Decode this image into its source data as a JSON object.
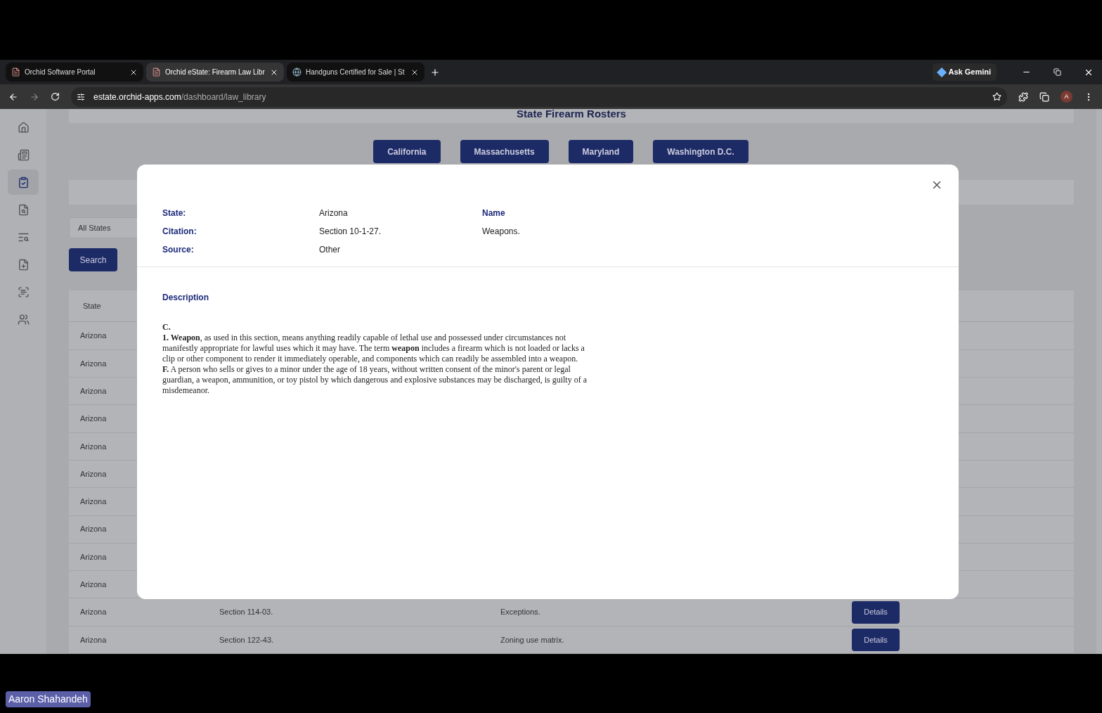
{
  "browser": {
    "tabs": [
      {
        "title": "Orchid Software Portal",
        "selected": false
      },
      {
        "title": "Orchid eState: Firearm Law Libr",
        "selected": true
      },
      {
        "title": "Handguns Certified for Sale | St",
        "selected": false
      }
    ],
    "gemini": "Ask Gemini",
    "url_host": "estate.orchid-apps.com",
    "url_path": "/dashboard/law_library",
    "profile": "A"
  },
  "sidebar": {
    "items": [
      {
        "kind": "home",
        "selected": false
      },
      {
        "kind": "news",
        "selected": false
      },
      {
        "kind": "clipboard",
        "selected": true
      },
      {
        "kind": "file-search",
        "selected": false
      },
      {
        "kind": "list-search",
        "selected": false
      },
      {
        "kind": "file-plus",
        "selected": false
      },
      {
        "kind": "scan",
        "selected": false
      },
      {
        "kind": "users",
        "selected": false
      }
    ]
  },
  "page": {
    "heading": "State Firearm Rosters",
    "roster_buttons": [
      "California",
      "Massachusetts",
      "Maryland",
      "Washington D.C."
    ],
    "state_filter": "All States",
    "search_button": "Search",
    "table": {
      "columns": [
        "State"
      ],
      "rows": [
        {
          "state": "Arizona"
        },
        {
          "state": "Arizona"
        },
        {
          "state": "Arizona"
        },
        {
          "state": "Arizona"
        },
        {
          "state": "Arizona"
        },
        {
          "state": "Arizona"
        },
        {
          "state": "Arizona"
        },
        {
          "state": "Arizona"
        },
        {
          "state": "Arizona"
        },
        {
          "state": "Arizona"
        },
        {
          "state": "Arizona",
          "citation": "Section 114-03.",
          "name": "Exceptions.",
          "action": "Details"
        },
        {
          "state": "Arizona",
          "citation": "Section 122-43.",
          "name": "Zoning use matrix.",
          "action": "Details"
        }
      ]
    }
  },
  "modal": {
    "fields": [
      {
        "label": "State:",
        "value": "Arizona"
      },
      {
        "label": "Citation:",
        "value": "Section 10-1-27."
      },
      {
        "label": "Source:",
        "value": "Other"
      }
    ],
    "name_label": "Name",
    "name_value": "Weapons.",
    "description_label": "Description",
    "description": [
      "**C.**",
      "**1. Weapon**, as used in this section, means anything readily capable of lethal use and possessed under circumstances not manifestly appropriate for lawful uses which it may have. The term **weapon** includes a firearm which is not loaded or lacks a clip or other component to render it immediately operable, and components which can readily be assembled into a weapon.",
      "**F.** A person who sells or gives to a minor under the age of 18 years, without written consent of the minor's parent or legal guardian, a weapon, ammunition, or toy pistol by which dangerous and explosive substances may be discharged, is guilty of a misdemeanor."
    ]
  },
  "participant_label": "Aaron Shahandeh"
}
